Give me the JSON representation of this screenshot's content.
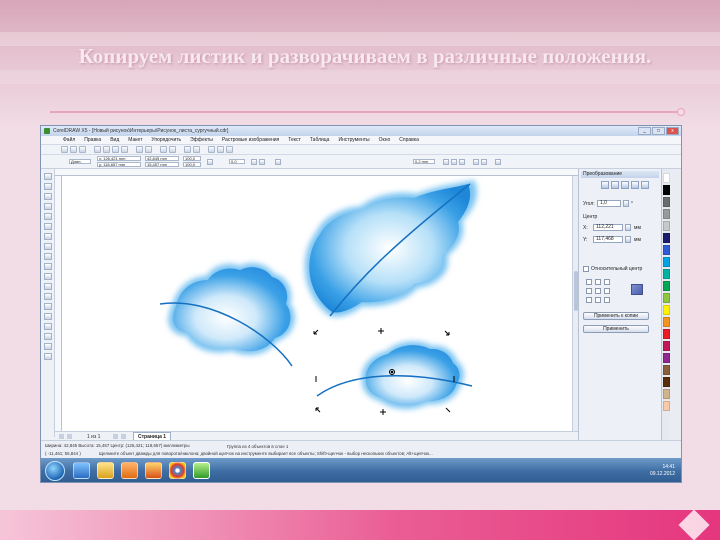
{
  "slide": {
    "title": "Копируем листик и разворачиваем в различные положения."
  },
  "window": {
    "title": "CorelDRAW X5 - [Новый рисунок\\Интерьеры\\Рисунок_листа_сургучный.cdr]",
    "controls": [
      "_",
      "□",
      "x"
    ]
  },
  "menu": [
    "Файл",
    "Правка",
    "Вид",
    "Макет",
    "Упорядочить",
    "Эффекты",
    "Растровые изображения",
    "Текст",
    "Таблица",
    "Инструменты",
    "Окно",
    "Справка"
  ],
  "propbar": {
    "preset": "Длин.",
    "x": "x: 126,421 mm",
    "y": "y: 118,657 mm",
    "w": "42,845 mm",
    "h": "15,457 mm",
    "scale_w": "100,0",
    "scale_h": "100,0",
    "angle": "0,0",
    "outline": "0,2 mm"
  },
  "page": {
    "count": "1 из 1",
    "tab_label": "Страница 1"
  },
  "status": {
    "line1": "Ширина: 42,845 Высота: 15,457 Центр: (126,421; 118,657) миллиметры",
    "line1b": "Группа из 4 объектов в слое 1",
    "line2": "( -11,461; 55,844 )",
    "line2b": "Щелкните объект дважды для поворота/наклона; двойной щелчок на инструменте выбирает все объекты; Shift+щелчок - выбор нескольких объектов; Alt+щелчок..."
  },
  "taskbar": {
    "time": "14:41",
    "date": "09.12.2012",
    "apps": [
      "ie-icon",
      "folder-icon",
      "media-icon",
      "firefox-icon",
      "chrome-icon",
      "corel-icon"
    ]
  },
  "docker": {
    "title": "Преобразование",
    "angle_label": "Угол:",
    "angle_value": "1,0",
    "angle_unit": "°",
    "center_label": "Центр",
    "x_label": "X:",
    "x_value": "112,221",
    "y_label": "Y:",
    "y_value": "117,468",
    "unit": "мм",
    "relative_label": "Относительный центр",
    "apply_dup_label": "Применить к копии",
    "apply_label": "Применить"
  },
  "palette": [
    "#ffffff",
    "#000000",
    "#6b6b6b",
    "#9a9a9a",
    "#c8c8c8",
    "#1c1c6e",
    "#2f5bd8",
    "#00a4e4",
    "#00b3a0",
    "#00a651",
    "#8dc63f",
    "#fff200",
    "#f7941d",
    "#ed1c24",
    "#c2185b",
    "#92278f",
    "#8b5e3c",
    "#5a2d0c",
    "#d2b48c",
    "#f9c9a8"
  ]
}
